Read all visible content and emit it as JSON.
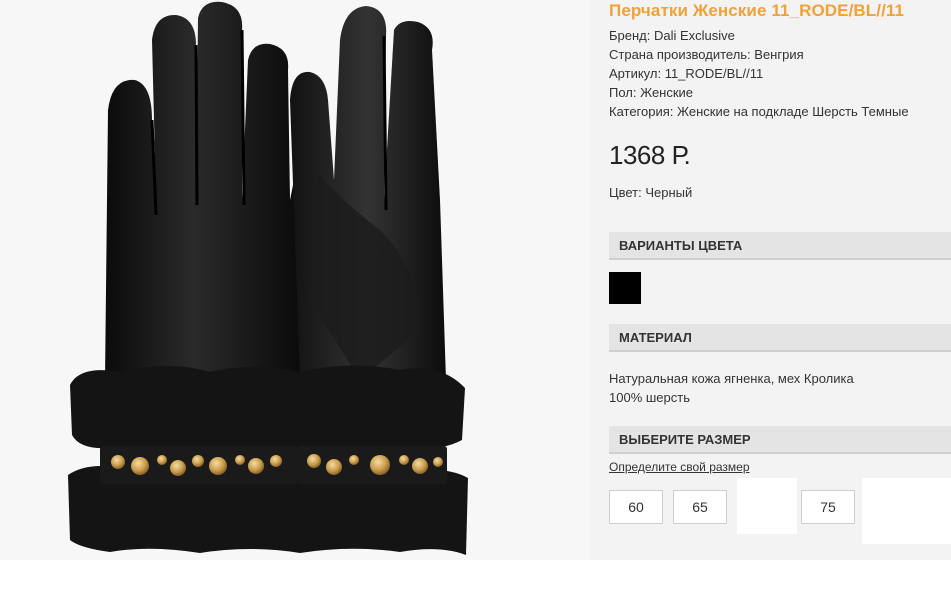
{
  "product": {
    "title": "Перчатки Женские 11_RODE/BL//11",
    "specs": [
      "Бренд: Dali Exclusive",
      "Страна производитель: Венгрия",
      "Артикул: 11_RODE/BL//11",
      "Пол: Женские",
      "Категория: Женские на подкладе Шерсть Темные"
    ],
    "price": "1368 Р.",
    "color": "Цвет: Черный"
  },
  "sections": {
    "color_variants": "ВАРИАНТЫ ЦВЕТА",
    "material": "МАТЕРИАЛ",
    "size": "ВЫБЕРИТЕ РАЗМЕР"
  },
  "material_lines": [
    "Натуральная кожа ягненка, мех Кролика",
    "100% шерсть"
  ],
  "size_link": "Определите свой размер",
  "sizes": [
    "60",
    "65",
    "75"
  ],
  "swatch_color": "#000000",
  "accent_color": "#f0a23a",
  "product_image_icon": "black-leather-gloves-fur-studs"
}
